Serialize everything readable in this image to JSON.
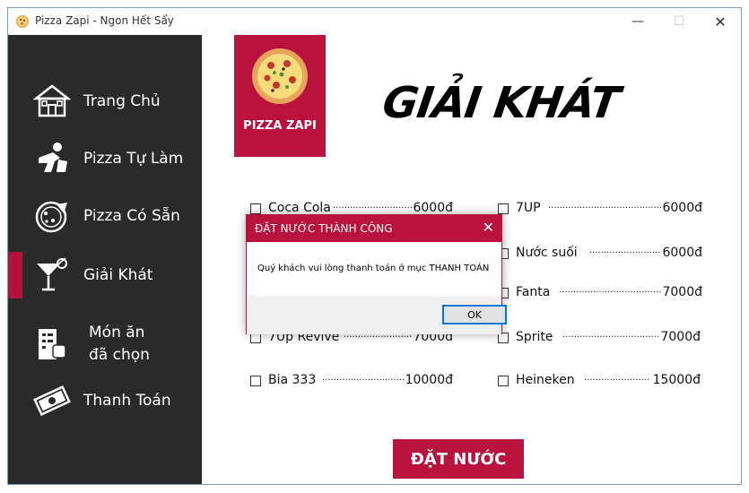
{
  "window": {
    "title": "Pizza Zapi - Ngon Hết Sẩy"
  },
  "sidebar": {
    "items": [
      {
        "label": "Trang Chủ",
        "icon": "house-icon"
      },
      {
        "label": "Pizza Tự Làm",
        "icon": "chef-icon"
      },
      {
        "label": "Pizza Có Sẵn",
        "icon": "pizza-icon"
      },
      {
        "label": "Giải Khát",
        "icon": "cocktail-icon",
        "active": true
      },
      {
        "label": "Món ăn\nđã chọn",
        "icon": "receipt-icon"
      },
      {
        "label": "Thanh Toán",
        "icon": "money-icon"
      }
    ]
  },
  "logo": {
    "text": "PIZZA ZAPI"
  },
  "page": {
    "title": "GIẢI KHÁT"
  },
  "drinks": [
    {
      "name": "Coca Cola",
      "price": "6000đ"
    },
    {
      "name": "7UP",
      "price": "6000đ"
    },
    {
      "name": "Nước suối",
      "price": "6000đ"
    },
    {
      "name": "Fanta",
      "price": "7000đ"
    },
    {
      "name": "7Up Revive",
      "price": "7000đ"
    },
    {
      "name": "Sprite",
      "price": "7000đ"
    },
    {
      "name": "Bia 333",
      "price": "10000đ"
    },
    {
      "name": "Heineken",
      "price": "15000đ"
    }
  ],
  "order_button": {
    "label": "ĐẶT NƯỚC"
  },
  "dialog": {
    "title": "ĐẶT NƯỚC THÀNH CÔNG",
    "message": "Quý khách vui lòng thanh toán ở mục THANH TOÁN",
    "ok_label": "OK"
  },
  "colors": {
    "accent": "#b9123d",
    "sidebar_bg": "#2a2a2a"
  }
}
